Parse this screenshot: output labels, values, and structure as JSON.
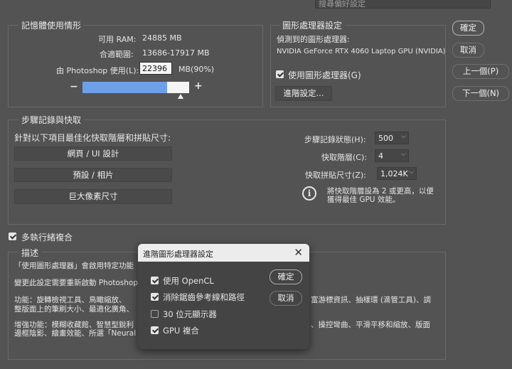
{
  "search": {
    "placeholder": "搜尋偏好設定"
  },
  "memory": {
    "title": "記憶體使用情形",
    "available_label": "可用 RAM:",
    "available_value": "24885 MB",
    "ideal_label": "合適範圍:",
    "ideal_value": "13686-17917 MB",
    "usage_label": "由 Photoshop 使用(L):",
    "usage_value": "22396",
    "usage_percent": "MB(90%)",
    "minus": "−",
    "plus": "+",
    "slider_level_percent": 90
  },
  "gpu": {
    "title": "圖形處理器設定",
    "detected_label": "偵測到的圖形處理器:",
    "gpu_name": "NVIDIA GeForce RTX 4060 Laptop GPU (NVIDIA)",
    "use_gpu_label": "使用圖形處理器(G)",
    "use_gpu_checked": true,
    "advanced_button": "進階設定..."
  },
  "side_buttons": {
    "ok": "確定",
    "cancel": "取消",
    "prev": "上一個(P)",
    "next": "下一個(N)"
  },
  "history": {
    "title": "步驟記錄與快取",
    "optimize_label": "針對以下項目最佳化快取階層和拼貼尺寸:",
    "preset_buttons": [
      "網頁 / UI 設計",
      "預設 / 相片",
      "巨大像素尺寸"
    ],
    "states_label": "步驟記錄狀態(H):",
    "states_value": "500",
    "cache_levels_label": "快取階層(C):",
    "cache_levels_value": "4",
    "tile_size_label": "快取拼貼尺寸(Z):",
    "tile_size_value": "1,024K",
    "info_line1": "將快取階層設為 2 或更高，以便",
    "info_line2": "獲得最佳 GPU 效能。"
  },
  "multithread": {
    "label": "多執行緒複合",
    "checked": true
  },
  "description": {
    "title": "描述",
    "line1": "「使用圖形處理器」會啟用特定功能",
    "line2": "變更此設定需要重新啟動 Photoshop",
    "line3a": "功能：旋轉檢視工具、鳥瞰縮放、",
    "line3b": "富游標資訊、抽樣環 (滴管工具)、調",
    "line4": "整版面上的筆刷大小、最適化廣角、",
    "line5a": "增強功能：模糊收藏館、智慧型銳利",
    "line5b": "、操控彎曲、平滑平移和縮放、版面",
    "line6": "邊框陰影、繪畫效能、所選「Neural"
  },
  "dialog": {
    "title": "進階圖形處理器設定",
    "options": [
      {
        "label": "使用 OpenCL",
        "checked": true
      },
      {
        "label": "消除鋸齒參考線和路徑",
        "checked": true
      },
      {
        "label": "30 位元顯示器",
        "checked": false
      },
      {
        "label": "GPU 複合",
        "checked": true
      }
    ],
    "ok": "確定",
    "cancel": "取消"
  },
  "colors": {
    "background": "#535353",
    "slider_fill": "#6ea0ea",
    "dialog_bg": "#444444",
    "dialog_titlebar": "#ececec"
  }
}
